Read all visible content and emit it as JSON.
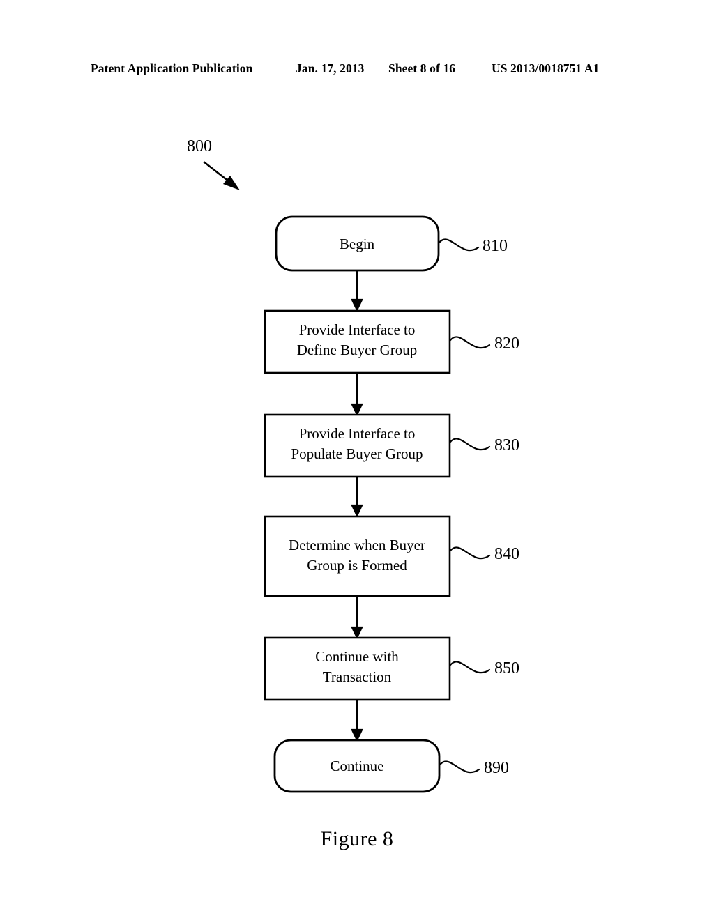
{
  "header": {
    "publication": "Patent Application Publication",
    "date": "Jan. 17, 2013",
    "sheet": "Sheet 8 of 16",
    "patent_number": "US 2013/0018751 A1"
  },
  "figure": {
    "caption": "Figure 8",
    "diagram_ref": "800"
  },
  "chart_data": {
    "type": "flowchart",
    "title": "Figure 8",
    "diagram_reference": "800",
    "orientation": "top-to-bottom",
    "nodes": [
      {
        "id": "810",
        "label": "Begin",
        "shape": "terminator",
        "ref": "810"
      },
      {
        "id": "820",
        "label": "Provide Interface to Define Buyer Group",
        "line1": "Provide Interface to",
        "line2": "Define Buyer Group",
        "shape": "process",
        "ref": "820"
      },
      {
        "id": "830",
        "label": "Provide Interface to Populate Buyer Group",
        "line1": "Provide Interface to",
        "line2": "Populate Buyer Group",
        "shape": "process",
        "ref": "830"
      },
      {
        "id": "840",
        "label": "Determine when Buyer Group is Formed",
        "line1": "Determine when Buyer",
        "line2": "Group is Formed",
        "shape": "process",
        "ref": "840"
      },
      {
        "id": "850",
        "label": "Continue with Transaction",
        "line1": "Continue with",
        "line2": "Transaction",
        "shape": "process",
        "ref": "850"
      },
      {
        "id": "890",
        "label": "Continue",
        "shape": "terminator",
        "ref": "890"
      }
    ],
    "edges": [
      {
        "from": "810",
        "to": "820"
      },
      {
        "from": "820",
        "to": "830"
      },
      {
        "from": "830",
        "to": "840"
      },
      {
        "from": "840",
        "to": "850"
      },
      {
        "from": "850",
        "to": "890"
      }
    ],
    "colors": {
      "stroke": "#000000",
      "fill": "#ffffff",
      "background": "#ffffff"
    }
  }
}
